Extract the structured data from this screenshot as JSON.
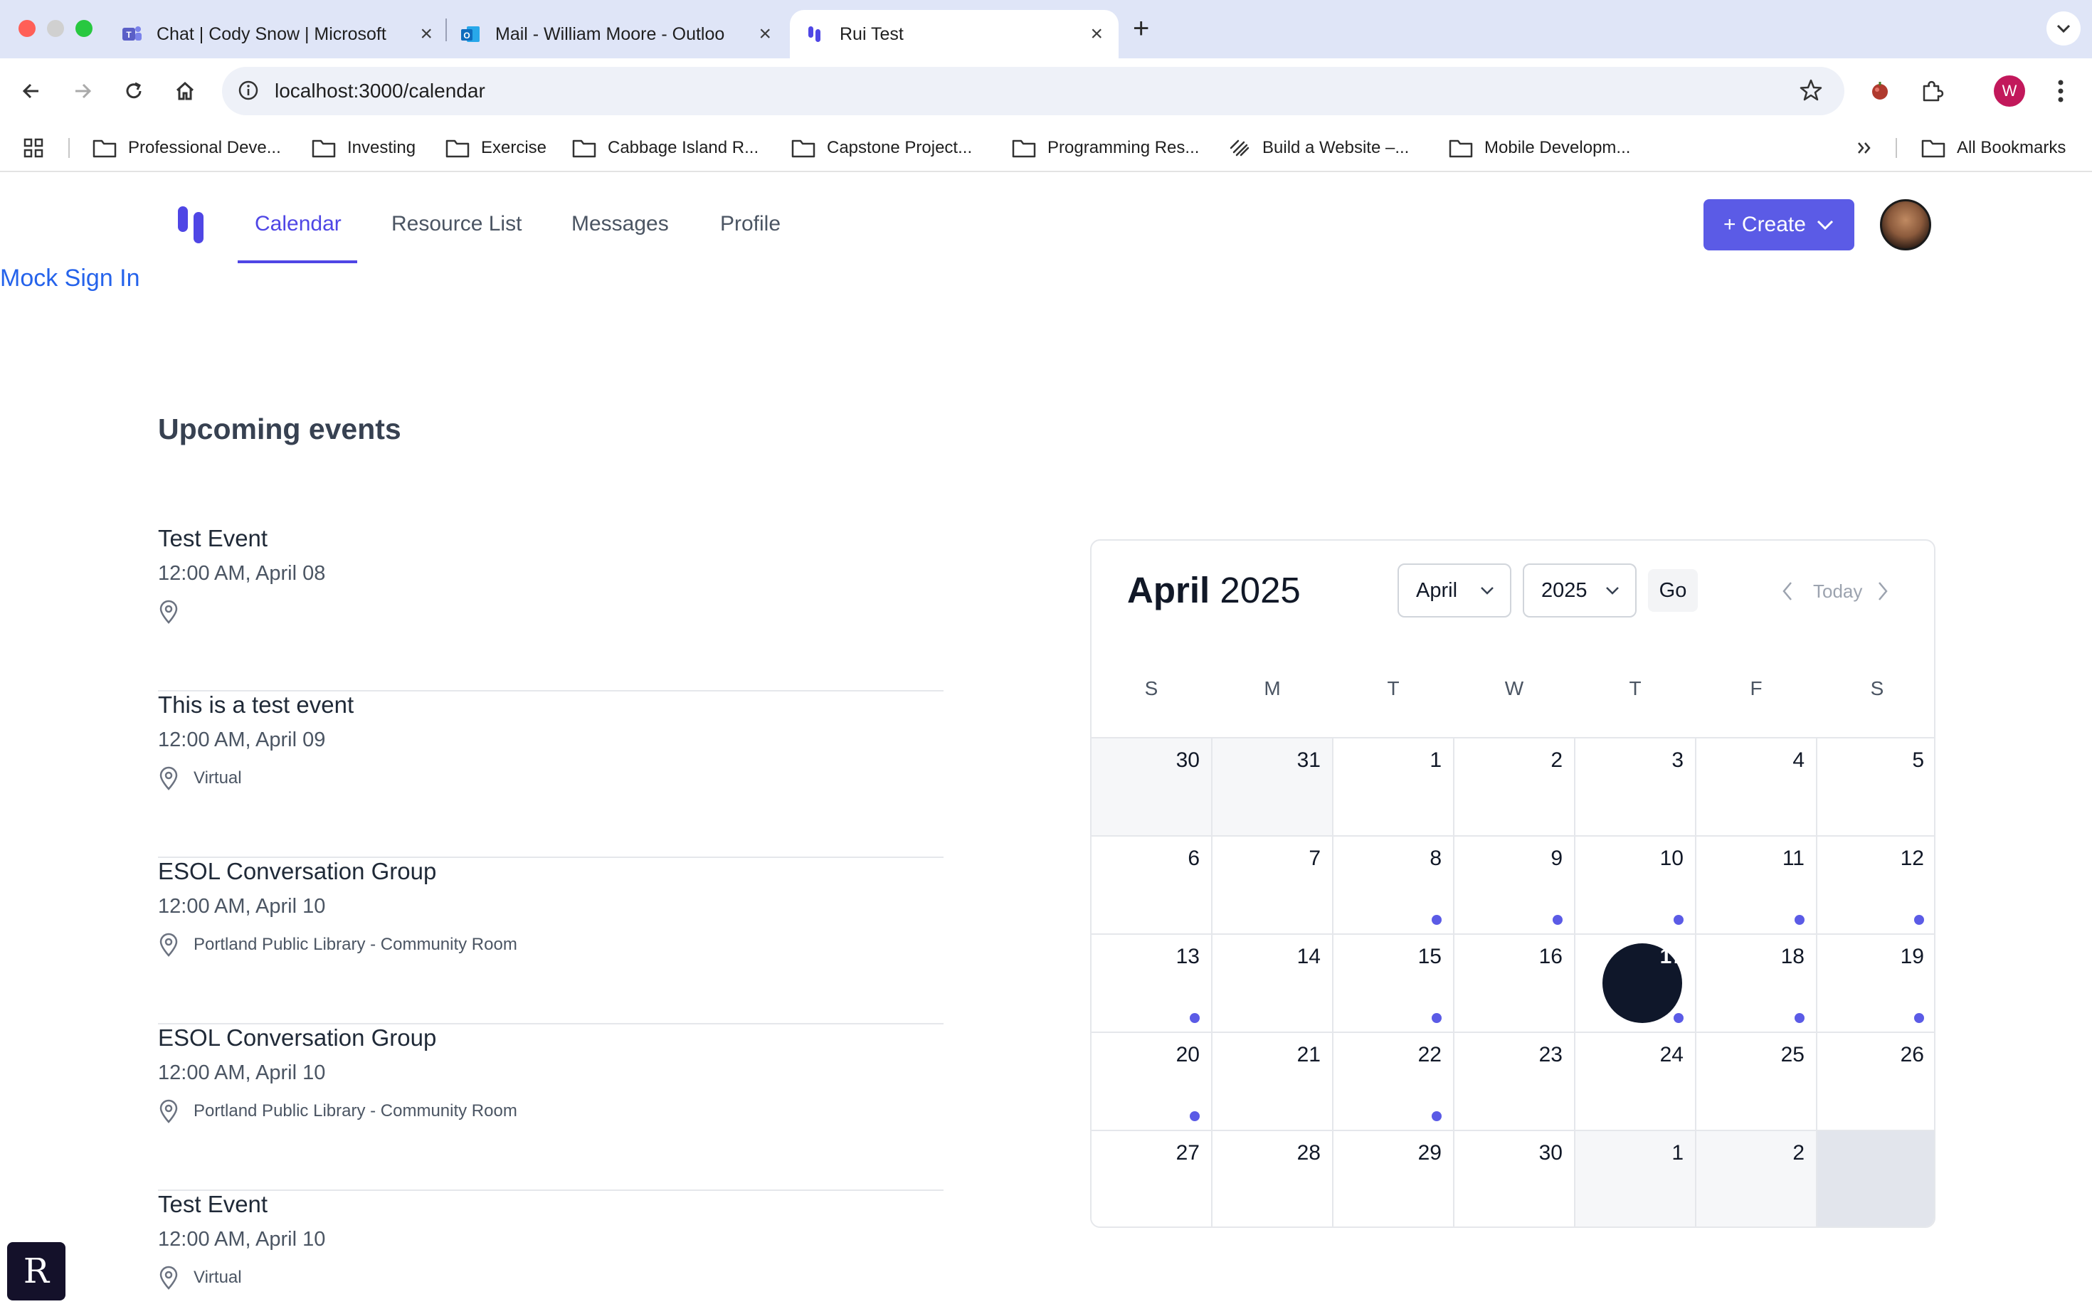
{
  "browser": {
    "tabs": [
      {
        "label": "Chat | Cody Snow | Microsoft",
        "icon": "teams-icon"
      },
      {
        "label": "Mail - William Moore - Outloo",
        "icon": "outlook-icon"
      },
      {
        "label": "Rui Test",
        "icon": "app-logo-icon"
      }
    ],
    "url": "localhost:3000/calendar",
    "profile_initial": "W",
    "bookmarks": [
      "Professional Deve...",
      "Investing",
      "Exercise",
      "Cabbage Island R...",
      "Capstone Project...",
      "Programming Res...",
      "Build a Website –...",
      "Mobile Developm..."
    ],
    "all_bookmarks": "All Bookmarks"
  },
  "app": {
    "nav": [
      "Calendar",
      "Resource List",
      "Messages",
      "Profile"
    ],
    "active_nav": "Calendar",
    "create_label": "+ Create",
    "mock_sign_in": "Mock Sign In",
    "accent_color": "#5b5be6"
  },
  "events_section": {
    "title": "Upcoming events",
    "events": [
      {
        "title": "Test Event",
        "time": "12:00 AM, April 08",
        "location": ""
      },
      {
        "title": "This is a test event",
        "time": "12:00 AM, April 09",
        "location": "Virtual"
      },
      {
        "title": "ESOL Conversation Group",
        "time": "12:00 AM, April 10",
        "location": "Portland Public Library - Community Room"
      },
      {
        "title": "ESOL Conversation Group",
        "time": "12:00 AM, April 10",
        "location": "Portland Public Library - Community Room"
      },
      {
        "title": "Test Event",
        "time": "12:00 AM, April 10",
        "location": "Virtual"
      }
    ]
  },
  "calendar": {
    "month": "April",
    "year": "2025",
    "month_select": "April",
    "year_select": "2025",
    "go_label": "Go",
    "today_label": "Today",
    "weekdays": [
      "S",
      "M",
      "T",
      "W",
      "T",
      "F",
      "S"
    ],
    "weeks": [
      [
        {
          "d": "30",
          "out": true
        },
        {
          "d": "31",
          "out": true
        },
        {
          "d": "1"
        },
        {
          "d": "2"
        },
        {
          "d": "3"
        },
        {
          "d": "4"
        },
        {
          "d": "5"
        }
      ],
      [
        {
          "d": "6"
        },
        {
          "d": "7"
        },
        {
          "d": "8",
          "dot": true
        },
        {
          "d": "9",
          "dot": true
        },
        {
          "d": "10",
          "dot": true
        },
        {
          "d": "11",
          "dot": true
        },
        {
          "d": "12",
          "dot": true
        }
      ],
      [
        {
          "d": "13",
          "dot": true
        },
        {
          "d": "14"
        },
        {
          "d": "15",
          "dot": true
        },
        {
          "d": "16"
        },
        {
          "d": "17",
          "today": true,
          "dot": true
        },
        {
          "d": "18",
          "dot": true
        },
        {
          "d": "19",
          "dot": true
        }
      ],
      [
        {
          "d": "20",
          "dot": true
        },
        {
          "d": "21"
        },
        {
          "d": "22",
          "dot": true
        },
        {
          "d": "23"
        },
        {
          "d": "24"
        },
        {
          "d": "25"
        },
        {
          "d": "26"
        }
      ],
      [
        {
          "d": "27"
        },
        {
          "d": "28"
        },
        {
          "d": "29"
        },
        {
          "d": "30"
        },
        {
          "d": "1",
          "out": true
        },
        {
          "d": "2",
          "out": true
        },
        {
          "d": "",
          "blank": true
        }
      ]
    ]
  }
}
